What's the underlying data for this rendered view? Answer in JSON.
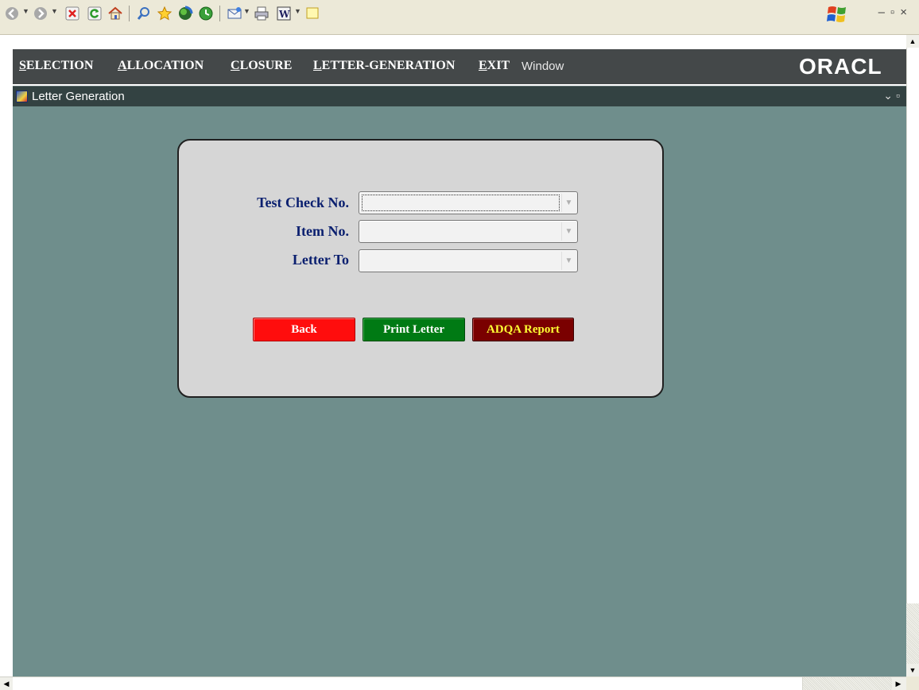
{
  "toolbar": {
    "icons": [
      "back-icon",
      "forward-icon",
      "stop-icon",
      "refresh-icon",
      "home-icon",
      "search-icon",
      "favorites-icon",
      "media-icon",
      "history-icon",
      "mail-icon",
      "print-icon",
      "edit-word-icon",
      "discuss-icon"
    ]
  },
  "menu": {
    "items": [
      {
        "first": "S",
        "rest": "ELECTION"
      },
      {
        "first": "A",
        "rest": "LLOCATION"
      },
      {
        "first": "C",
        "rest": "LOSURE"
      },
      {
        "first": "L",
        "rest": "ETTER-GENERATION"
      },
      {
        "first": "E",
        "rest": "XIT"
      }
    ],
    "window": "Window",
    "brand": "ORACL"
  },
  "window": {
    "title": "Letter Generation"
  },
  "form": {
    "fields": [
      {
        "label": "Test Check No.",
        "value": ""
      },
      {
        "label": "Item No.",
        "value": ""
      },
      {
        "label": "Letter To",
        "value": ""
      }
    ],
    "buttons": {
      "back": "Back",
      "print": "Print Letter",
      "adqa": "ADQA Report"
    }
  },
  "colors": {
    "canvas": "#6f8e8c",
    "panel": "#d6d6d6",
    "label": "#0a1f6f",
    "back_btn": "#ff0d0d",
    "print_btn": "#007a14",
    "adqa_btn": "#7a0000"
  }
}
